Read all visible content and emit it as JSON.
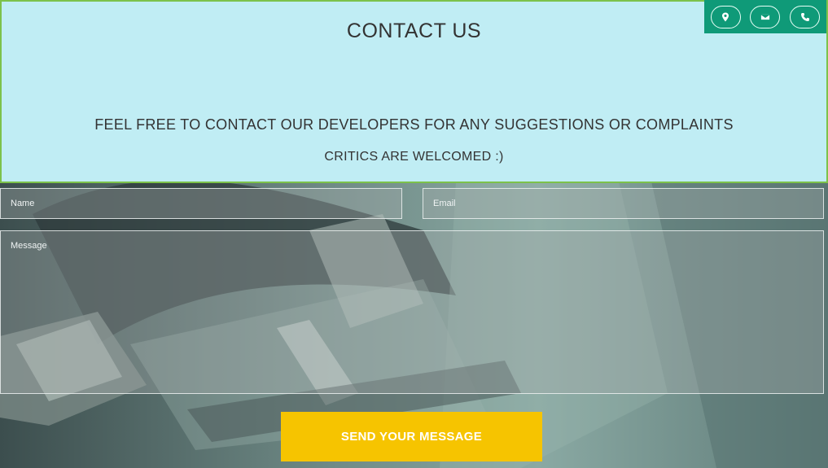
{
  "header": {
    "title": "CONTACT US",
    "line1": "FEEL FREE TO CONTACT OUR DEVELOPERS FOR ANY SUGGESTIONS OR COMPLAINTS",
    "line2": "CRITICS ARE WELCOMED :)",
    "icons": [
      "map-marker-icon",
      "envelope-icon",
      "phone-icon"
    ]
  },
  "form": {
    "name_placeholder": "Name",
    "email_placeholder": "Email",
    "message_placeholder": "Message",
    "send_label": "SEND YOUR MESSAGE"
  },
  "colors": {
    "header_bg": "#c0edf4",
    "header_border": "#7cc24a",
    "icon_bar": "#0f9a78",
    "send_button": "#f6c400"
  }
}
